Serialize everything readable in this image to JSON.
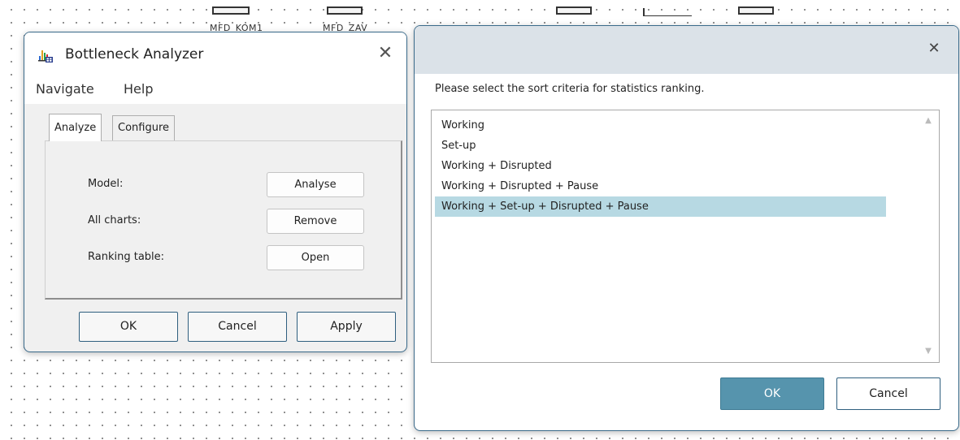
{
  "canvas": {
    "objects": [
      {
        "label": "MFD_KOM1"
      },
      {
        "label": "MFD_ZAV"
      }
    ]
  },
  "bottleneck_analyzer": {
    "title": "Bottleneck Analyzer",
    "close_glyph": "✕",
    "menu": [
      "Navigate",
      "Help"
    ],
    "tabs": [
      {
        "label": "Analyze",
        "active": true
      },
      {
        "label": "Configure",
        "active": false
      }
    ],
    "rows": [
      {
        "label": "Model:",
        "button": "Analyse"
      },
      {
        "label": "All charts:",
        "button": "Remove"
      },
      {
        "label": "Ranking table:",
        "button": "Open"
      }
    ],
    "footer": {
      "ok": "OK",
      "cancel": "Cancel",
      "apply": "Apply"
    }
  },
  "sort_dialog": {
    "close_glyph": "✕",
    "prompt": "Please select the sort criteria for statistics ranking.",
    "criteria": [
      "Working",
      "Set-up",
      "Working + Disrupted",
      "Working + Disrupted + Pause",
      "Working + Set-up + Disrupted + Pause"
    ],
    "selected_index": 4,
    "ok": "OK",
    "cancel": "Cancel"
  },
  "colors": {
    "selection": "#b7d9e3",
    "primary_button": "#5694ad",
    "title_bar": "#dbe2e8",
    "window_border": "#3a6a8a"
  }
}
